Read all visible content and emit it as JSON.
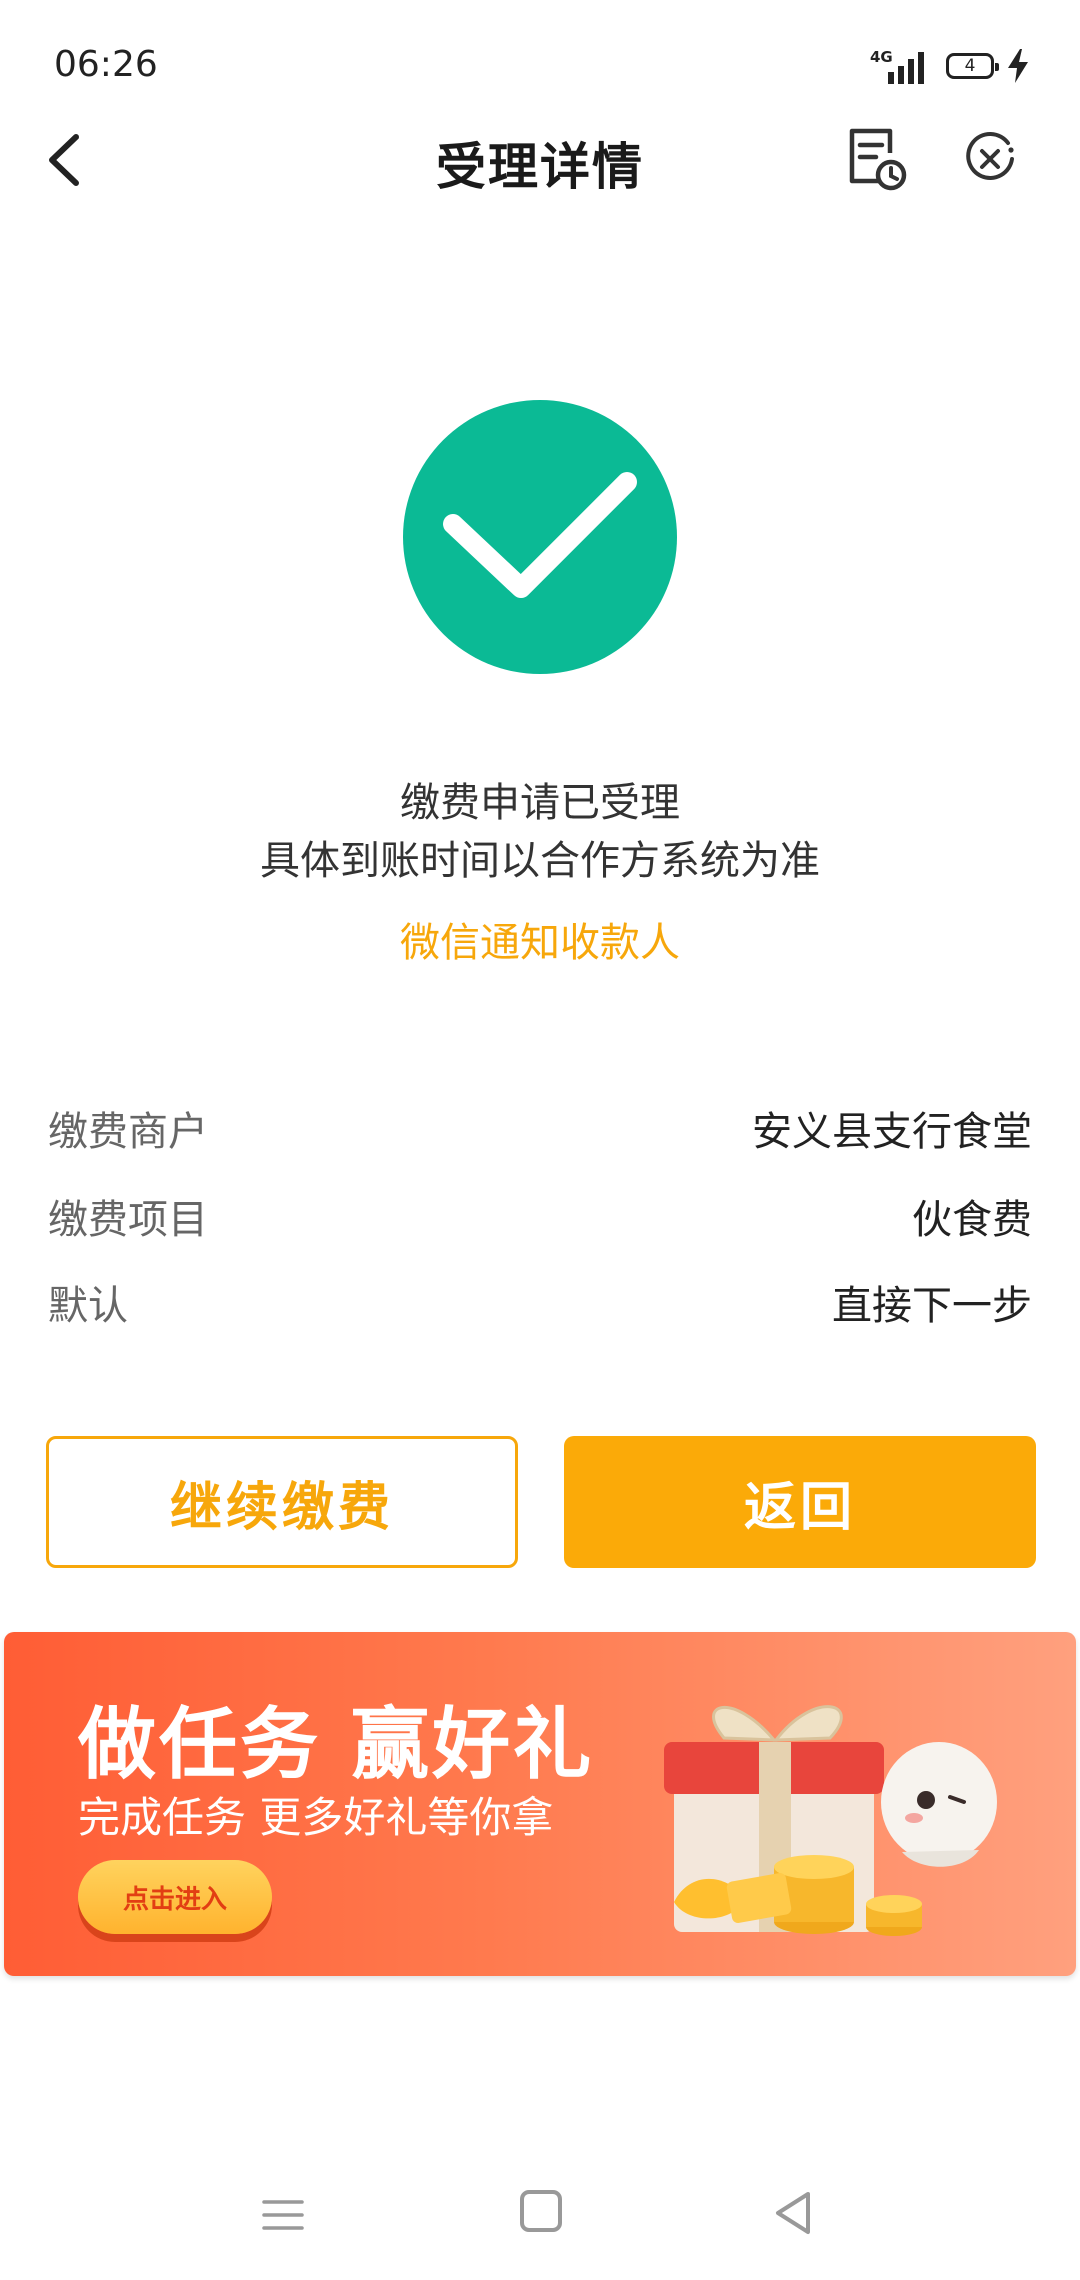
{
  "status": {
    "time": "06:26",
    "network": "4G",
    "battery": "4"
  },
  "nav": {
    "title": "受理详情"
  },
  "result": {
    "line1": "缴费申请已受理",
    "line2": "具体到账时间以合作方系统为准",
    "notify_link": "微信通知收款人"
  },
  "details": [
    {
      "label": "缴费商户",
      "value": "安义县支行食堂"
    },
    {
      "label": "缴费项目",
      "value": "伙食费"
    },
    {
      "label": "默认",
      "value": "直接下一步"
    }
  ],
  "buttons": {
    "continue_label": "继续缴费",
    "back_label": "返回"
  },
  "banner": {
    "title": "做任务 赢好礼",
    "subtitle": "完成任务 更多好礼等你拿",
    "cta": "点击进入"
  },
  "colors": {
    "success": "#0bba95",
    "accent": "#fbaa08",
    "banner_start": "#ff5d35",
    "banner_end": "#ffa07e"
  },
  "icons": {
    "back": "chevron-left-icon",
    "history": "document-clock-icon",
    "close": "close-circle-icon",
    "success": "checkmark-circle-icon"
  }
}
